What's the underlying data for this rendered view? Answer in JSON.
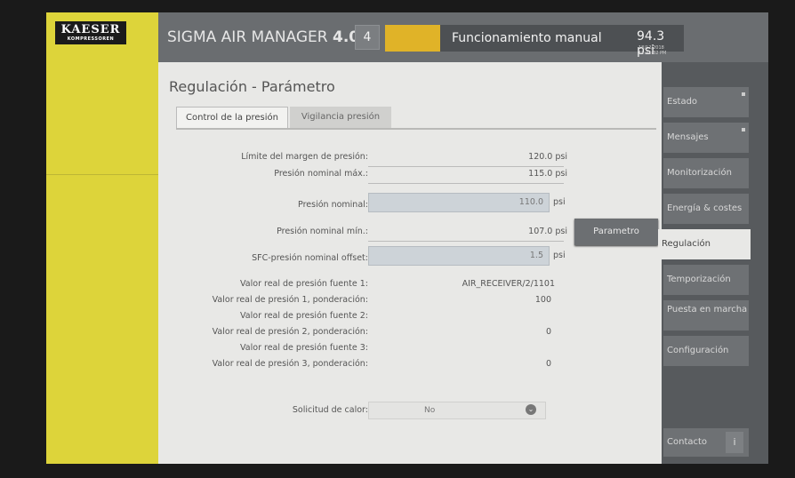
{
  "logo": {
    "line1": "KAESER",
    "line2": "KOMPRESSOREN"
  },
  "header": {
    "title_prefix": "SIGMA AIR MANAGER",
    "title_version": "4.0",
    "badge": "4",
    "status_text": "Funcionamiento manual",
    "pressure": "94.3 psi",
    "timestamp": "18/12/2018 11:41:32 PM"
  },
  "page": {
    "title": "Regulación - Parámetro"
  },
  "tabs": [
    {
      "label": "Control de la presión"
    },
    {
      "label": "Vigilancia presión"
    }
  ],
  "form": {
    "limite_label": "Límite del margen de presión:",
    "limite_value": "120.0 psi",
    "nominal_max_label": "Presión nominal máx.:",
    "nominal_max_value": "115.0 psi",
    "nominal_label": "Presión nominal:",
    "nominal_value": "110.0",
    "nominal_unit": "psi",
    "nominal_min_label": "Presión nominal mín.:",
    "nominal_min_value": "107.0 psi",
    "sfc_label": "SFC-presión nominal offset:",
    "sfc_value": "1.5",
    "sfc_unit": "psi",
    "fuente1_label": "Valor real de presión fuente 1:",
    "fuente1_value": "AIR_RECEIVER/2/1101",
    "pond1_label": "Valor real de presión 1, ponderación:",
    "pond1_value": "100",
    "fuente2_label": "Valor real de presión fuente 2:",
    "pond2_label": "Valor real de presión 2, ponderación:",
    "pond2_value": "0",
    "fuente3_label": "Valor real de presión fuente 3:",
    "pond3_label": "Valor real de presión 3, ponderación:",
    "pond3_value": "0",
    "calor_label": "Solicitud de calor:",
    "calor_value": "No"
  },
  "tooltip": "Parametro",
  "nav": {
    "estado": "Estado",
    "mensajes": "Mensajes",
    "monitorizacion": "Monitorización",
    "energia": "Energía & costes",
    "regulacion": "Regulación",
    "temporizacion": "Temporización",
    "puesta_en_marcha": "Puesta en marcha",
    "configuracion": "Configuración",
    "contacto": "Contacto",
    "info": "i"
  },
  "colors": {
    "brand_yellow": "#ddd43a",
    "status_yellow": "#e0b328",
    "header_gray": "#6a6d70"
  }
}
